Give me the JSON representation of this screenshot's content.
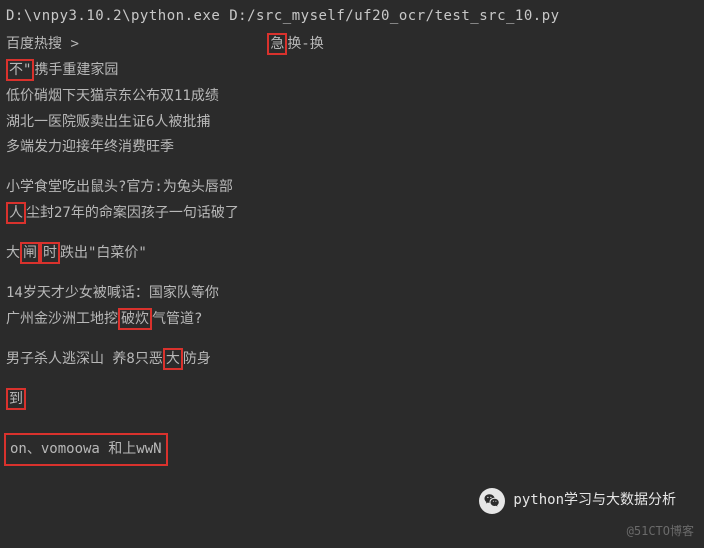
{
  "cmd": "D:\\vnpy3.10.2\\python.exe D:/src_myself/uf20_ocr/test_src_10.py",
  "header": {
    "label": "百度热搜",
    "arrow": ">",
    "swap_a": "急",
    "swap_mid": "换-换"
  },
  "lines": {
    "l1a": "不\"",
    "l1b": "携手重建家园",
    "l2": "低价硝烟下天猫京东公布双11成绩",
    "l3": "湖北一医院贩卖出生证6人被批捕",
    "l4": "多端发力迎接年终消费旺季",
    "l5": "小学食堂吃出鼠头?官方:为兔头唇部",
    "l6a": "人",
    "l6b": "尘封27年的命案因孩子一句话破了",
    "l7a": "大",
    "l7b": "闸",
    "l7c": "时",
    "l7d": "跌出\"白菜价\"",
    "l8": "14岁天才少女被喊话：国家队等你",
    "l9a": "广州金沙洲工地挖",
    "l9b": "破炊",
    "l9c": "气管道?",
    "l10a": "男子杀人逃深山  养8只恶",
    "l10b": "大",
    "l10c": "防身",
    "l11": "到",
    "bottom": "on、vomoowa  和上wwN"
  },
  "brand": "python学习与大数据分析",
  "watermark": "@51CTO博客"
}
